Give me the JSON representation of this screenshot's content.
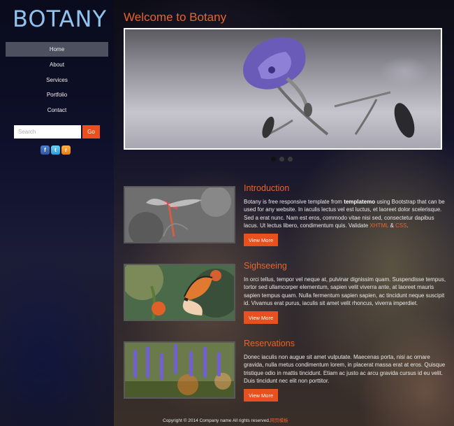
{
  "brand": {
    "logo": "BOTANY"
  },
  "nav": {
    "items": [
      {
        "label": "Home",
        "active": true
      },
      {
        "label": "About"
      },
      {
        "label": "Services"
      },
      {
        "label": "Portfolio"
      },
      {
        "label": "Contact"
      }
    ]
  },
  "search": {
    "placeholder": "Search",
    "button": "Go"
  },
  "social": {
    "icons": [
      "facebook-icon",
      "twitter-icon",
      "rss-icon"
    ],
    "fb": "f",
    "tw": "t",
    "rss": "r"
  },
  "main": {
    "title": "Welcome to Botany"
  },
  "slider": {
    "dot_count": 3,
    "active_dot": 0
  },
  "sections": [
    {
      "title": "Introduction",
      "text_a": "Botany is free responsive template from ",
      "text_bold": "templatemo",
      "text_b": " using Bootstrap that can be used for any website. In iaculis lectus vel est luctus, et laoreet dolor scelerisque. Sed a erat nunc. Nam est eros, commodo vitae nisi sed, consectetur dapibus lacus. Ut lectus libero, condimentum quis. Validate ",
      "link1": "XHTML",
      "amp": " & ",
      "link2": "CSS",
      "dot": ".",
      "button": "View More"
    },
    {
      "title": "Sighseeing",
      "text": "In orci tellus, tempor vel neque at, pulvinar dignissim quam. Suspendisse tempus, tortor sed ullamcorper elementum, sapien velit viverra ante, at laoreet mauris sapien tempus quam. Nulla fermentum sapien sapien, ac tincidunt neque suscipit id. Vivamus erat purus, iaculis sit amet velit rhoncus, viverra imperdiet.",
      "button": "View More"
    },
    {
      "title": "Reservations",
      "text": "Donec iaculis non augue sit amet vulputate. Maecenas porta, nisi ac ornare gravida, nulla metus condimentum lorem, in placerat massa erat at eros. Quisque tristique odio in mattis tincidunt. Etiam ac justo ac arcu gravida cursus id eu velit. Duis tincidunt nec elit non porttitor.",
      "button": "View More"
    }
  ],
  "footer": {
    "text": "Copyright © 2014 Company name All rights reserved.",
    "cn": "网页模板"
  },
  "colors": {
    "accent": "#e8501d",
    "title": "#e8642c",
    "logo": "#8fc3ee",
    "nav_active": "#4d505e"
  }
}
